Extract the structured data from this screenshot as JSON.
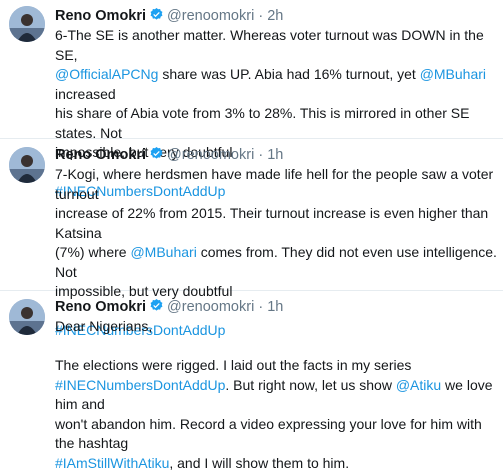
{
  "tweets": [
    {
      "name": "Reno Omokri",
      "handle": "@renoomokri",
      "time": "2h",
      "line1": "6-The SE is another matter. Whereas voter turnout was DOWN in the SE,",
      "line2_link1": "@OfficialAPCNg",
      "line2_text": " share was UP. Abia had 16% turnout, yet ",
      "line2_link2": "@MBuhari",
      "line2_text2": " increased",
      "line3": "his share of Abia vote from 3% to 28%. This is mirrored in other SE states. Not",
      "line4": "impossible, but very doubtful",
      "hashtag": "#INECNumbersDontAddUp"
    },
    {
      "name": "Reno Omokri",
      "handle": "@renoomokri",
      "time": "1h",
      "line1": "7-Kogi, where herdsmen have made life hell for the people saw a voter turnout",
      "line2": "increase of 22% from 2015. Their turnout increase is even higher than Katsina",
      "line3_text": "(7%) where ",
      "line3_link": "@MBuhari",
      "line3_text2": " comes from. They did not even use intelligence. Not",
      "line4": "impossible, but very doubtful",
      "hashtag": "#INECNumbersDontAddUp"
    },
    {
      "name": "Reno Omokri",
      "handle": "@renoomokri",
      "time": "1h",
      "line1": "Dear Nigerians,",
      "line2": "The elections were rigged. I laid out the facts in my series",
      "line3_link": "#INECNumbersDontAddUp",
      "line3_text": ". But right now, let us show ",
      "line3_link2": "@Atiku",
      "line3_text2": " we love him and",
      "line4": "won't abandon him. Record a video expressing your love for him with the hashtag",
      "line5_link": "#IAmStillWithAtiku",
      "line5_text": ", and I will show them to him."
    }
  ],
  "colors": {
    "link": "#1b95e0",
    "verified": "#1da1f2",
    "meta": "#657786"
  },
  "icons": {
    "verified": "verified-badge-icon",
    "avatar": "profile-photo"
  }
}
